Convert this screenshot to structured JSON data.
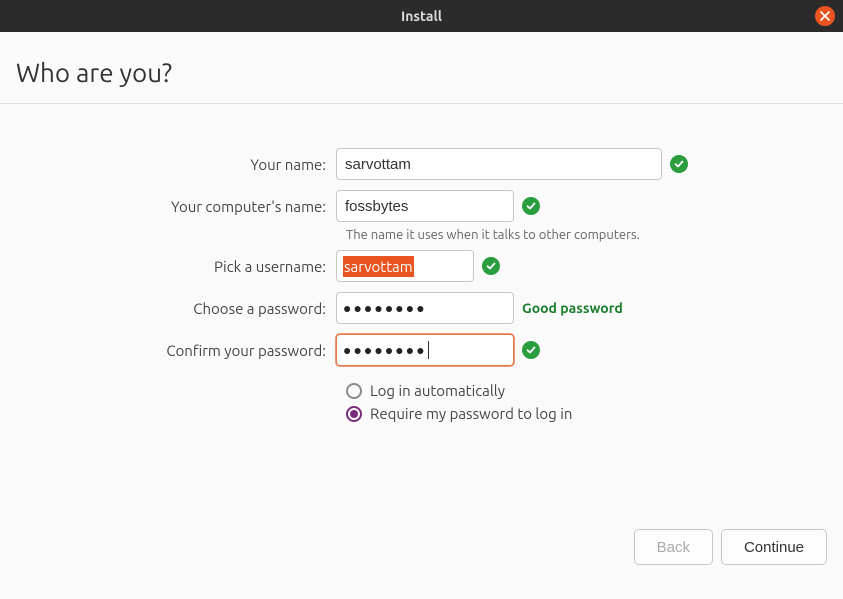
{
  "window": {
    "title": "Install"
  },
  "heading": "Who are you?",
  "labels": {
    "your_name": "Your name:",
    "computer_name": "Your computer's name:",
    "computer_hint": "The name it uses when it talks to other computers.",
    "pick_username": "Pick a username:",
    "choose_password": "Choose a password:",
    "confirm_password": "Confirm your password:"
  },
  "values": {
    "your_name": "sarvottam",
    "computer_name": "fossbytes",
    "username": "sarvottam",
    "password_mask": "●●●●●●●●",
    "confirm_mask": "●●●●●●●●",
    "password_strength": "Good password"
  },
  "options": {
    "auto_login": "Log in automatically",
    "require_pw": "Require my password to log in",
    "selected": "require_pw"
  },
  "buttons": {
    "back": "Back",
    "continue": "Continue"
  }
}
